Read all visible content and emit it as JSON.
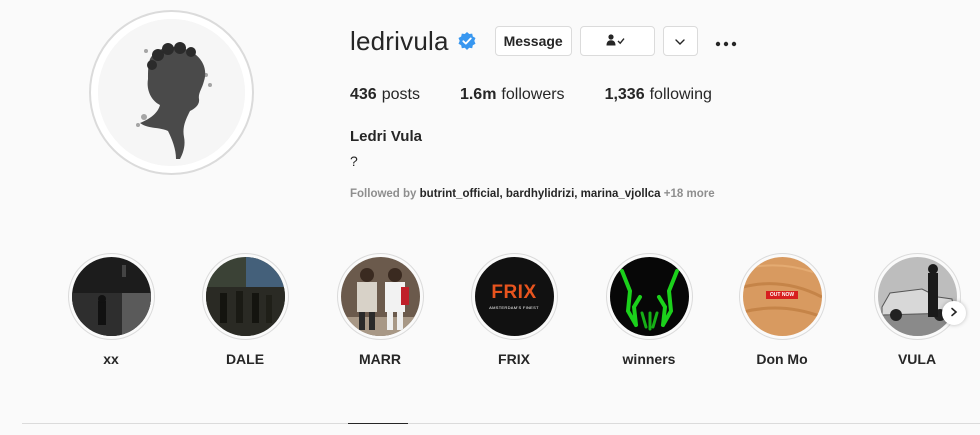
{
  "profile": {
    "username": "ledrivula",
    "verified": true,
    "full_name": "Ledri Vula",
    "bio": "?",
    "buttons": {
      "message": "Message",
      "follow_icon": "user-check-icon",
      "dropdown_icon": "chevron-down-icon",
      "more_icon": "more-options-icon"
    },
    "stats": {
      "posts_count": "436",
      "posts_label": "posts",
      "followers_count": "1.6m",
      "followers_label": "followers",
      "following_count": "1,336",
      "following_label": "following"
    },
    "followed_by": {
      "prefix": "Followed by",
      "names": "butrint_official, bardhylidrizi, marina_vjollca",
      "more": "+18 more"
    }
  },
  "highlights": [
    {
      "label": "xx"
    },
    {
      "label": "DALE"
    },
    {
      "label": "MARR"
    },
    {
      "label": "FRIX",
      "image_text": "FRIX",
      "image_subtext": "AMSTERDAM'S FINEST"
    },
    {
      "label": "winners"
    },
    {
      "label": "Don Mo",
      "image_text": "OUT NOW"
    },
    {
      "label": "VULA"
    }
  ],
  "colors": {
    "background": "#fafafa",
    "border": "#dbdbdb",
    "verified_blue": "#3897f0",
    "muted_text": "#8e8e8e",
    "frix_orange": "#e8541e",
    "winners_green": "#1bd11b"
  }
}
